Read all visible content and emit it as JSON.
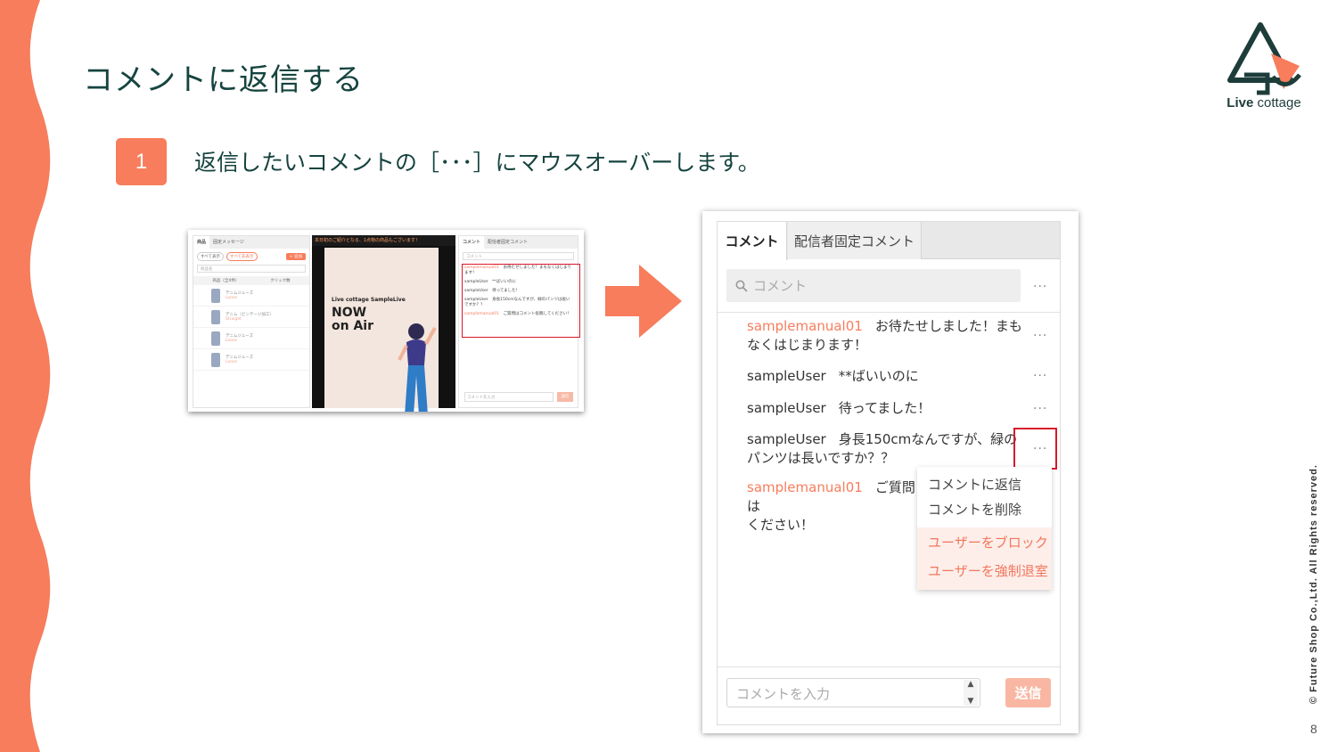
{
  "slide": {
    "title": "コメントに返信する",
    "step_number": "1",
    "step_text": "返信したいコメントの［･･･］にマウスオーバーします。",
    "copyright": "© Future Shop Co.,Ltd. All Rights reserved.",
    "page_number": "8",
    "logo_bold": "Live",
    "logo_light": " cottage"
  },
  "colors": {
    "accent": "#f77d5c",
    "teal": "#16443f",
    "highlight": "#d8182a"
  },
  "thumbnail": {
    "left_tabs": [
      "商品",
      "固定メッセージ"
    ],
    "filter_all": "すべて表示",
    "filter_shown": "すべて非表示",
    "add_label": "+ 追加",
    "search_placeholder": "商品名",
    "col_product": "商品（全4件）",
    "col_clicks": "クリック数",
    "products": [
      {
        "name": "デニムジューズ",
        "sub": "Loose"
      },
      {
        "name": "デニム（ビンテージ加工）",
        "sub": "Straight"
      },
      {
        "name": "デニムジューズ",
        "sub": "Loose"
      },
      {
        "name": "デニムジューズ",
        "sub": "Loose"
      }
    ],
    "banner": "本日初のご紹介となる、1点物の商品もございます！",
    "brand": "Live cottage SampleLive",
    "now": "NOW",
    "on_air": "on Air",
    "right_tabs": [
      "コメント",
      "配信者固定コメント"
    ],
    "comment_search": "コメント",
    "comments": [
      {
        "user": "samplemanual01",
        "text": "お待たせしました！まもなくはじまります！"
      },
      {
        "user": "sampleUser",
        "text": "**ばいいのに"
      },
      {
        "user": "sampleUser",
        "text": "待ってました！"
      },
      {
        "user": "sampleUser",
        "text": "身長150cmなんですが、緑のパンツは長いですか？？"
      },
      {
        "user": "samplemanual01",
        "text": "ご質問はコメント投稿してください！"
      }
    ],
    "input_placeholder": "コメントを入力",
    "send_label": "送信"
  },
  "panel": {
    "tabs": [
      "コメント",
      "配信者固定コメント"
    ],
    "search_placeholder": "コメント",
    "more": "···",
    "comments": [
      {
        "user": "samplemanual01",
        "text": "お待たせしました！まもなくはじまります！"
      },
      {
        "user": "sampleUser",
        "text": "**ばいいのに"
      },
      {
        "user": "sampleUser",
        "text": "待ってました！"
      },
      {
        "user": "sampleUser",
        "text": "身長150cmなんですが、緑のパンツは長いですか？？"
      },
      {
        "user": "samplemanual01",
        "text": "ご質問は"
      },
      {
        "text2": "ください！"
      }
    ],
    "menu": {
      "reply": "コメントに返信",
      "delete": "コメントを削除",
      "block": "ユーザーをブロック",
      "kick": "ユーザーを強制退室"
    },
    "input_placeholder": "コメントを入力",
    "send_label": "送信"
  }
}
